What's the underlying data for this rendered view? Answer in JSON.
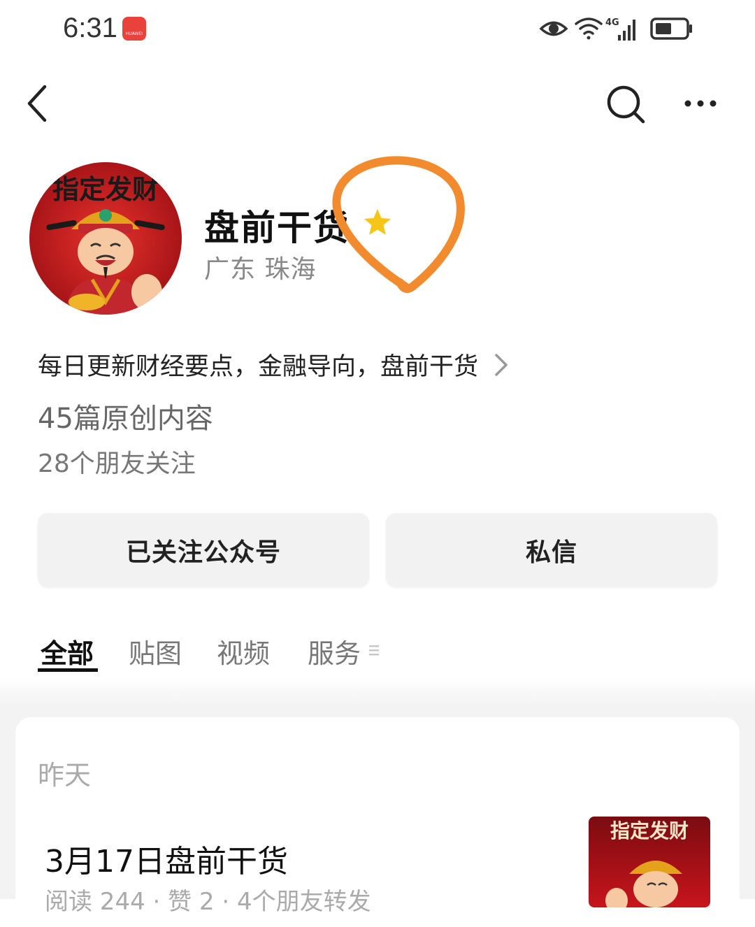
{
  "status_bar": {
    "time": "6:31",
    "brand_badge": "HUAWEI",
    "network": "4G",
    "icons": [
      "eye-icon",
      "wifi-icon",
      "signal-icon",
      "battery-icon"
    ]
  },
  "nav": {
    "icons": [
      "chevron-left-icon",
      "search-icon",
      "more-dots-icon"
    ]
  },
  "profile": {
    "avatar_caption": "指定发财",
    "name": "盘前干货",
    "badge": "star-icon",
    "location": "广东 珠海",
    "intro": "每日更新财经要点，金融导向，盘前干货",
    "originals": "45篇原创内容",
    "friends": "28个朋友关注"
  },
  "buttons": {
    "follow": "已关注公众号",
    "message": "私信"
  },
  "tabs": [
    {
      "label": "全部",
      "active": true
    },
    {
      "label": "贴图",
      "active": false
    },
    {
      "label": "视频",
      "active": false
    },
    {
      "label": "服务",
      "active": false
    }
  ],
  "feed": {
    "date": "昨天",
    "article": {
      "title": "3月17日盘前干货",
      "meta": "阅读 244 · 赞 2 · 4个朋友转发",
      "thumb_caption": "指定发财"
    }
  },
  "colors": {
    "star": "#f5c518",
    "annotation": "#f28a2e",
    "avatar_red": "#c8141c"
  }
}
